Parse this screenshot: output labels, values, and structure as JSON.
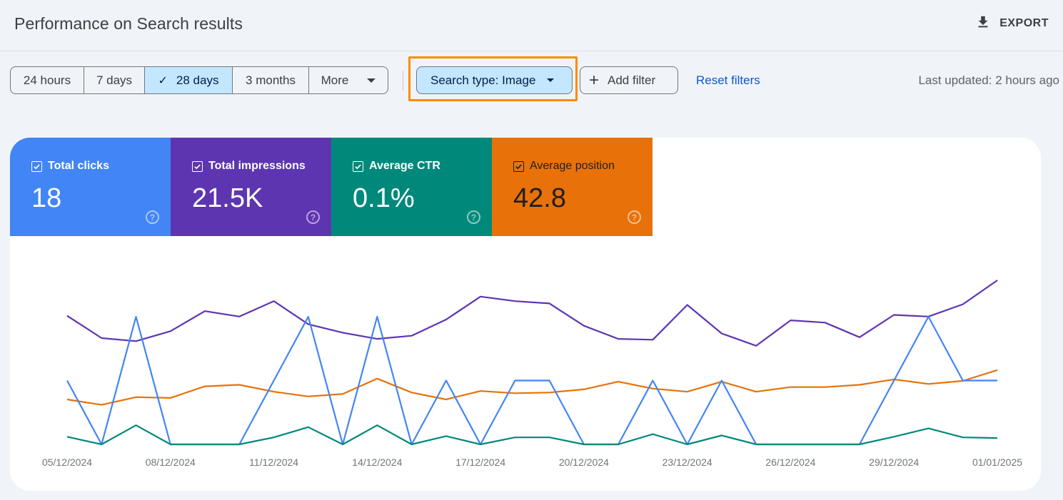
{
  "header": {
    "title": "Performance on Search results",
    "export_label": "EXPORT"
  },
  "toolbar": {
    "date_ranges": [
      {
        "label": "24 hours",
        "selected": false
      },
      {
        "label": "7 days",
        "selected": false
      },
      {
        "label": "28 days",
        "selected": true
      },
      {
        "label": "3 months",
        "selected": false
      },
      {
        "label": "More",
        "selected": false
      }
    ],
    "search_type_label": "Search type: Image",
    "add_filter_label": "Add filter",
    "reset_filters_label": "Reset filters",
    "last_updated": "Last updated: 2 hours ago"
  },
  "metrics": [
    {
      "key": "clicks",
      "label": "Total clicks",
      "value": "18",
      "checked": true,
      "color": "#4285f4"
    },
    {
      "key": "impressions",
      "label": "Total impressions",
      "value": "21.5K",
      "checked": true,
      "color": "#5e35b1"
    },
    {
      "key": "ctr",
      "label": "Average CTR",
      "value": "0.1%",
      "checked": true,
      "color": "#00897b"
    },
    {
      "key": "position",
      "label": "Average position",
      "value": "42.8",
      "checked": true,
      "color": "#e8710a"
    }
  ],
  "chart_data": {
    "type": "line",
    "title": "",
    "xlabel": "",
    "ylabel": "",
    "grid": false,
    "legend": "none",
    "x": [
      "05/12/2024",
      "06/12/2024",
      "07/12/2024",
      "08/12/2024",
      "09/12/2024",
      "10/12/2024",
      "11/12/2024",
      "12/12/2024",
      "13/12/2024",
      "14/12/2024",
      "15/12/2024",
      "16/12/2024",
      "17/12/2024",
      "18/12/2024",
      "19/12/2024",
      "20/12/2024",
      "21/12/2024",
      "22/12/2024",
      "23/12/2024",
      "24/12/2024",
      "25/12/2024",
      "26/12/2024",
      "27/12/2024",
      "28/12/2024",
      "29/12/2024",
      "30/12/2024",
      "31/12/2024",
      "01/01/2025"
    ],
    "x_tick_labels": [
      "05/12/2024",
      "08/12/2024",
      "11/12/2024",
      "14/12/2024",
      "17/12/2024",
      "20/12/2024",
      "23/12/2024",
      "26/12/2024",
      "29/12/2024",
      "01/01/2025"
    ],
    "series": [
      {
        "name": "Total impressions",
        "color": "#5e35b1",
        "ylim": [
          0,
          1000
        ],
        "values": [
          784,
          648,
          629,
          690,
          812,
          779,
          873,
          732,
          681,
          643,
          662,
          761,
          901,
          873,
          859,
          723,
          643,
          638,
          850,
          676,
          601,
          756,
          742,
          653,
          789,
          779,
          854,
          1000
        ]
      },
      {
        "name": "Average position",
        "color": "#e8710a",
        "ylim": [
          0,
          130
        ],
        "values": [
          35.6,
          31.3,
          37.4,
          36.8,
          46.0,
          47.2,
          41.7,
          38.0,
          39.9,
          52.1,
          41.1,
          35.6,
          42.3,
          40.5,
          41.1,
          43.6,
          49.7,
          44.2,
          41.7,
          49.7,
          41.7,
          45.4,
          45.4,
          47.2,
          51.5,
          47.9,
          50.3,
          58.9
        ]
      },
      {
        "name": "Total clicks",
        "color": "#4285f4",
        "ylim": [
          0,
          2.57
        ],
        "values": [
          1,
          0,
          2,
          0,
          0,
          0,
          1,
          2,
          0,
          2,
          0,
          1,
          0,
          1,
          1,
          0,
          0,
          1,
          0,
          1,
          0,
          0,
          0,
          0,
          1,
          2,
          1,
          1
        ]
      },
      {
        "name": "Average CTR",
        "color": "#00897b",
        "ylim": [
          0,
          2.57
        ],
        "values": [
          0.12,
          0,
          0.3,
          0,
          0,
          0,
          0.11,
          0.27,
          0,
          0.3,
          0,
          0.13,
          0,
          0.11,
          0.11,
          0,
          0,
          0.16,
          0,
          0.14,
          0,
          0,
          0,
          0,
          0.12,
          0.25,
          0.11,
          0.1
        ]
      }
    ]
  }
}
